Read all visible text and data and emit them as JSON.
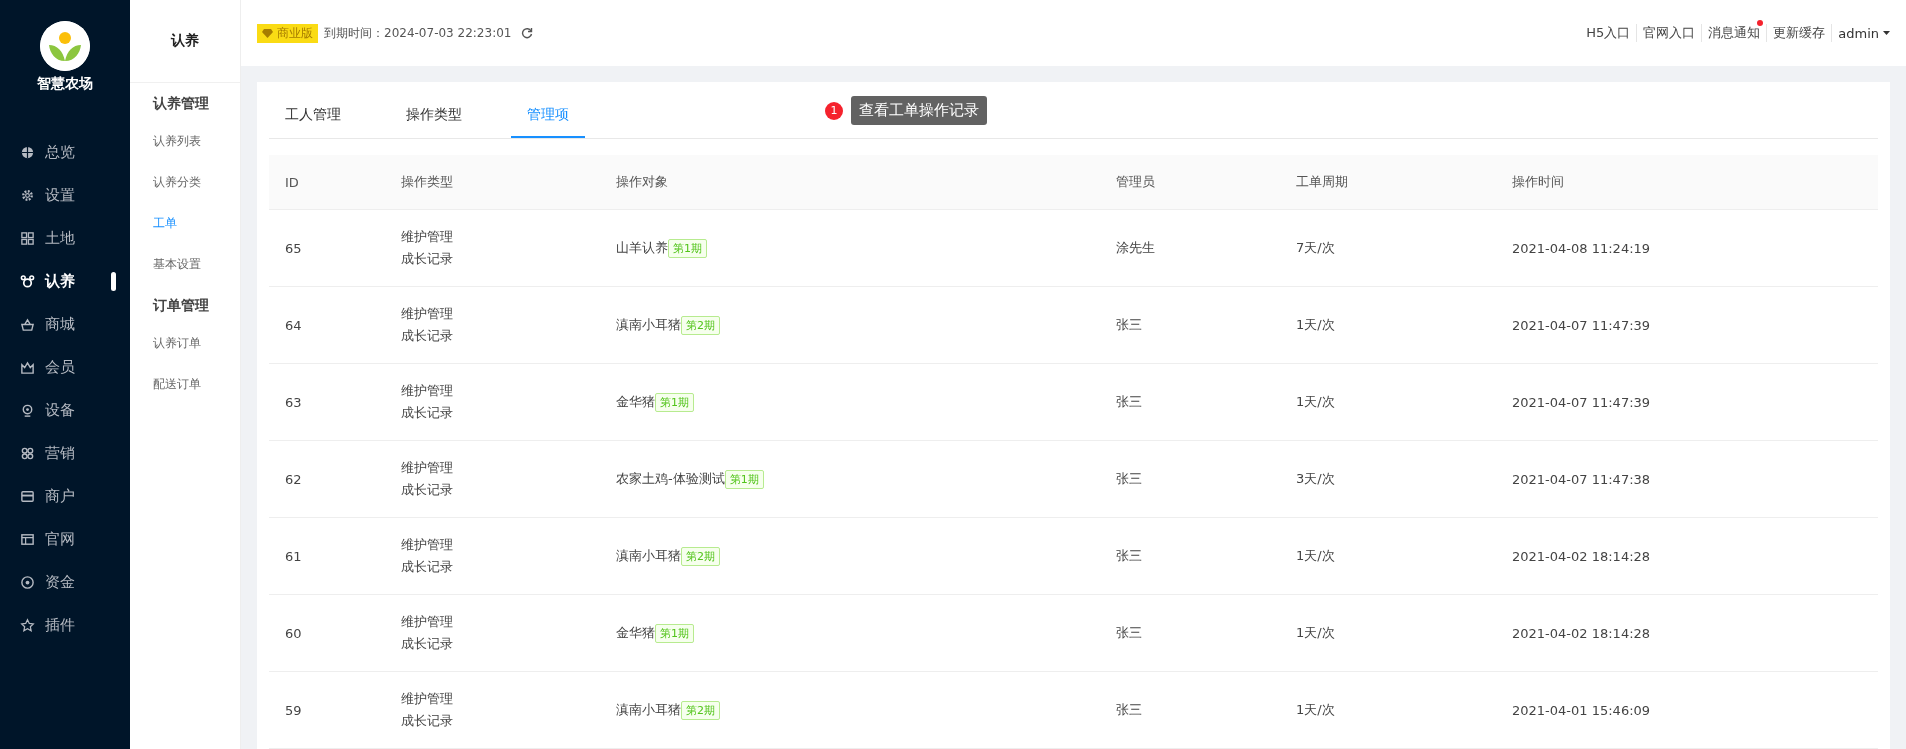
{
  "brand": {
    "name": "智慧农场"
  },
  "nav": [
    {
      "label": "总览",
      "selected": false
    },
    {
      "label": "设置",
      "selected": false
    },
    {
      "label": "土地",
      "selected": false
    },
    {
      "label": "认养",
      "selected": true
    },
    {
      "label": "商城",
      "selected": false
    },
    {
      "label": "会员",
      "selected": false
    },
    {
      "label": "设备",
      "selected": false
    },
    {
      "label": "营销",
      "selected": false
    },
    {
      "label": "商户",
      "selected": false
    },
    {
      "label": "官网",
      "selected": false
    },
    {
      "label": "资金",
      "selected": false
    },
    {
      "label": "插件",
      "selected": false
    }
  ],
  "submenu": {
    "title": "认养",
    "groups": [
      {
        "title": "认养管理",
        "items": [
          {
            "label": "认养列表",
            "selected": false
          },
          {
            "label": "认养分类",
            "selected": false
          },
          {
            "label": "工单",
            "selected": true
          },
          {
            "label": "基本设置",
            "selected": false
          }
        ]
      },
      {
        "title": "订单管理",
        "items": [
          {
            "label": "认养订单",
            "selected": false
          },
          {
            "label": "配送订单",
            "selected": false
          }
        ]
      }
    ]
  },
  "header": {
    "edition": "商业版",
    "expiry": "到期时间：2024-07-03 22:23:01",
    "links": [
      {
        "label": "H5入口",
        "notify": false
      },
      {
        "label": "官网入口",
        "notify": false
      },
      {
        "label": "消息通知",
        "notify": true
      },
      {
        "label": "更新缓存",
        "notify": false
      }
    ],
    "user": "admin"
  },
  "tabs": [
    {
      "label": "工人管理",
      "selected": false
    },
    {
      "label": "操作类型",
      "selected": false
    },
    {
      "label": "管理项",
      "selected": true
    }
  ],
  "guide": {
    "step": "1",
    "text": "查看工单操作记录"
  },
  "table": {
    "columns": [
      "ID",
      "操作类型",
      "操作对象",
      "管理员",
      "工单周期",
      "操作时间"
    ],
    "rows": [
      {
        "id": "65",
        "type": [
          "维护管理",
          "成长记录"
        ],
        "object": "山羊认养",
        "period": "第1期",
        "admin": "涂先生",
        "cycle": "7天/次",
        "time": "2021-04-08 11:24:19"
      },
      {
        "id": "64",
        "type": [
          "维护管理",
          "成长记录"
        ],
        "object": "滇南小耳猪",
        "period": "第2期",
        "admin": "张三",
        "cycle": "1天/次",
        "time": "2021-04-07 11:47:39"
      },
      {
        "id": "63",
        "type": [
          "维护管理",
          "成长记录"
        ],
        "object": "金华猪",
        "period": "第1期",
        "admin": "张三",
        "cycle": "1天/次",
        "time": "2021-04-07 11:47:39"
      },
      {
        "id": "62",
        "type": [
          "维护管理",
          "成长记录"
        ],
        "object": "农家土鸡-体验测试",
        "period": "第1期",
        "admin": "张三",
        "cycle": "3天/次",
        "time": "2021-04-07 11:47:38"
      },
      {
        "id": "61",
        "type": [
          "维护管理",
          "成长记录"
        ],
        "object": "滇南小耳猪",
        "period": "第2期",
        "admin": "张三",
        "cycle": "1天/次",
        "time": "2021-04-02 18:14:28"
      },
      {
        "id": "60",
        "type": [
          "维护管理",
          "成长记录"
        ],
        "object": "金华猪",
        "period": "第1期",
        "admin": "张三",
        "cycle": "1天/次",
        "time": "2021-04-02 18:14:28"
      },
      {
        "id": "59",
        "type": [
          "维护管理",
          "成长记录"
        ],
        "object": "滇南小耳猪",
        "period": "第2期",
        "admin": "张三",
        "cycle": "1天/次",
        "time": "2021-04-01 15:46:09"
      }
    ]
  }
}
